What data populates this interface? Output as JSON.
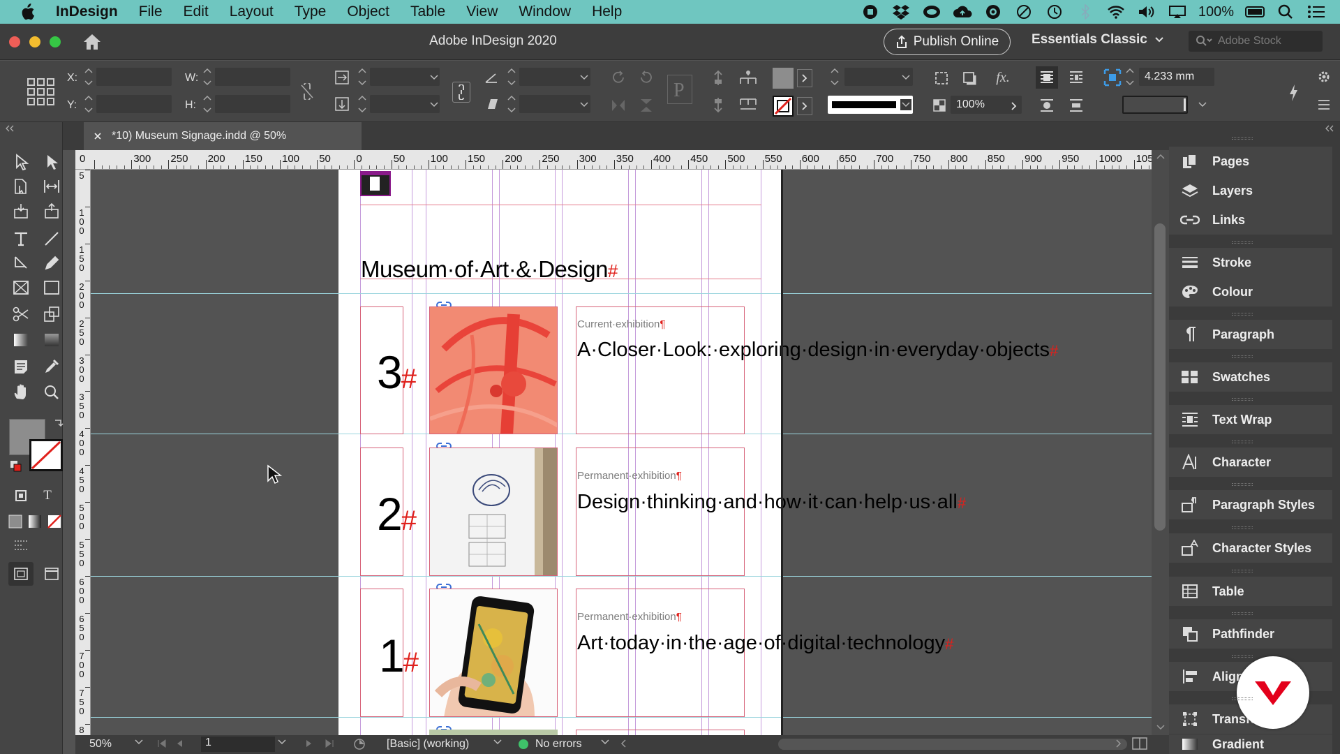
{
  "menubar": {
    "app_name": "InDesign",
    "items": [
      "File",
      "Edit",
      "Layout",
      "Type",
      "Object",
      "Table",
      "View",
      "Window",
      "Help"
    ],
    "battery": "100%"
  },
  "titlebar": {
    "title": "Adobe InDesign 2020",
    "publish_label": "Publish Online",
    "workspace": "Essentials Classic",
    "search_placeholder": "Adobe Stock"
  },
  "control": {
    "x_label": "X:",
    "y_label": "Y:",
    "w_label": "W:",
    "h_label": "H:",
    "scale_value": "100%",
    "offset_value": "4.233 mm",
    "fx_label": "fx."
  },
  "document": {
    "tab_title": "*10) Museum Signage.indd @ 50%"
  },
  "ruler": {
    "h_marks": [
      "0",
      "300",
      "250",
      "200",
      "150",
      "100",
      "50",
      "0",
      "50",
      "100",
      "150",
      "200",
      "250",
      "300",
      "350",
      "400",
      "450",
      "500",
      "550",
      "600",
      "650",
      "700",
      "750",
      "800",
      "850",
      "900",
      "950",
      "1000",
      "1050"
    ],
    "v_marks": [
      "5",
      "1 0 0",
      "1 5 0",
      "2 0 0",
      "2 5 0",
      "3 0 0",
      "3 5 0",
      "4 0 0",
      "4 5 0",
      "5 0 0",
      "5 5 0",
      "6 0 0",
      "6 5 0",
      "7 0 0",
      "7 5 0",
      "8"
    ]
  },
  "page": {
    "heading": "Museum·of·Art·&·Design",
    "heading_mark": "#",
    "rows": [
      {
        "number": "3",
        "mark": "#",
        "label": "Current·exhibition",
        "title": "A·Closer·Look:·exploring·design·in·everyday·objects",
        "end": "#"
      },
      {
        "number": "2",
        "mark": "#",
        "label": "Permanent·exhibition",
        "title": "Design·thinking·and·how·it·can·help·us·all",
        "end": "#"
      },
      {
        "number": "1",
        "mark": "#",
        "label": "Permanent·exhibition",
        "title": "Art·today·in·the·age·of·digital·technology",
        "end": "#"
      }
    ],
    "pilcrow": "¶"
  },
  "status": {
    "zoom": "50%",
    "page_number": "1",
    "profile": "[Basic] (working)",
    "errors": "No errors"
  },
  "panels": {
    "items": [
      "Pages",
      "Layers",
      "Links",
      "Stroke",
      "Colour",
      "Paragraph",
      "Swatches",
      "Text Wrap",
      "Character",
      "Paragraph Styles",
      "Character Styles",
      "Table",
      "Pathfinder",
      "Align",
      "Transform",
      "Gradient"
    ]
  },
  "colors": {
    "menubar_bg": "#6fc6c0",
    "accent_red": "#e0201b",
    "frame_pink": "#d66077",
    "guide_purple": "#c49adb",
    "guide_cyan": "#9bd5de"
  }
}
